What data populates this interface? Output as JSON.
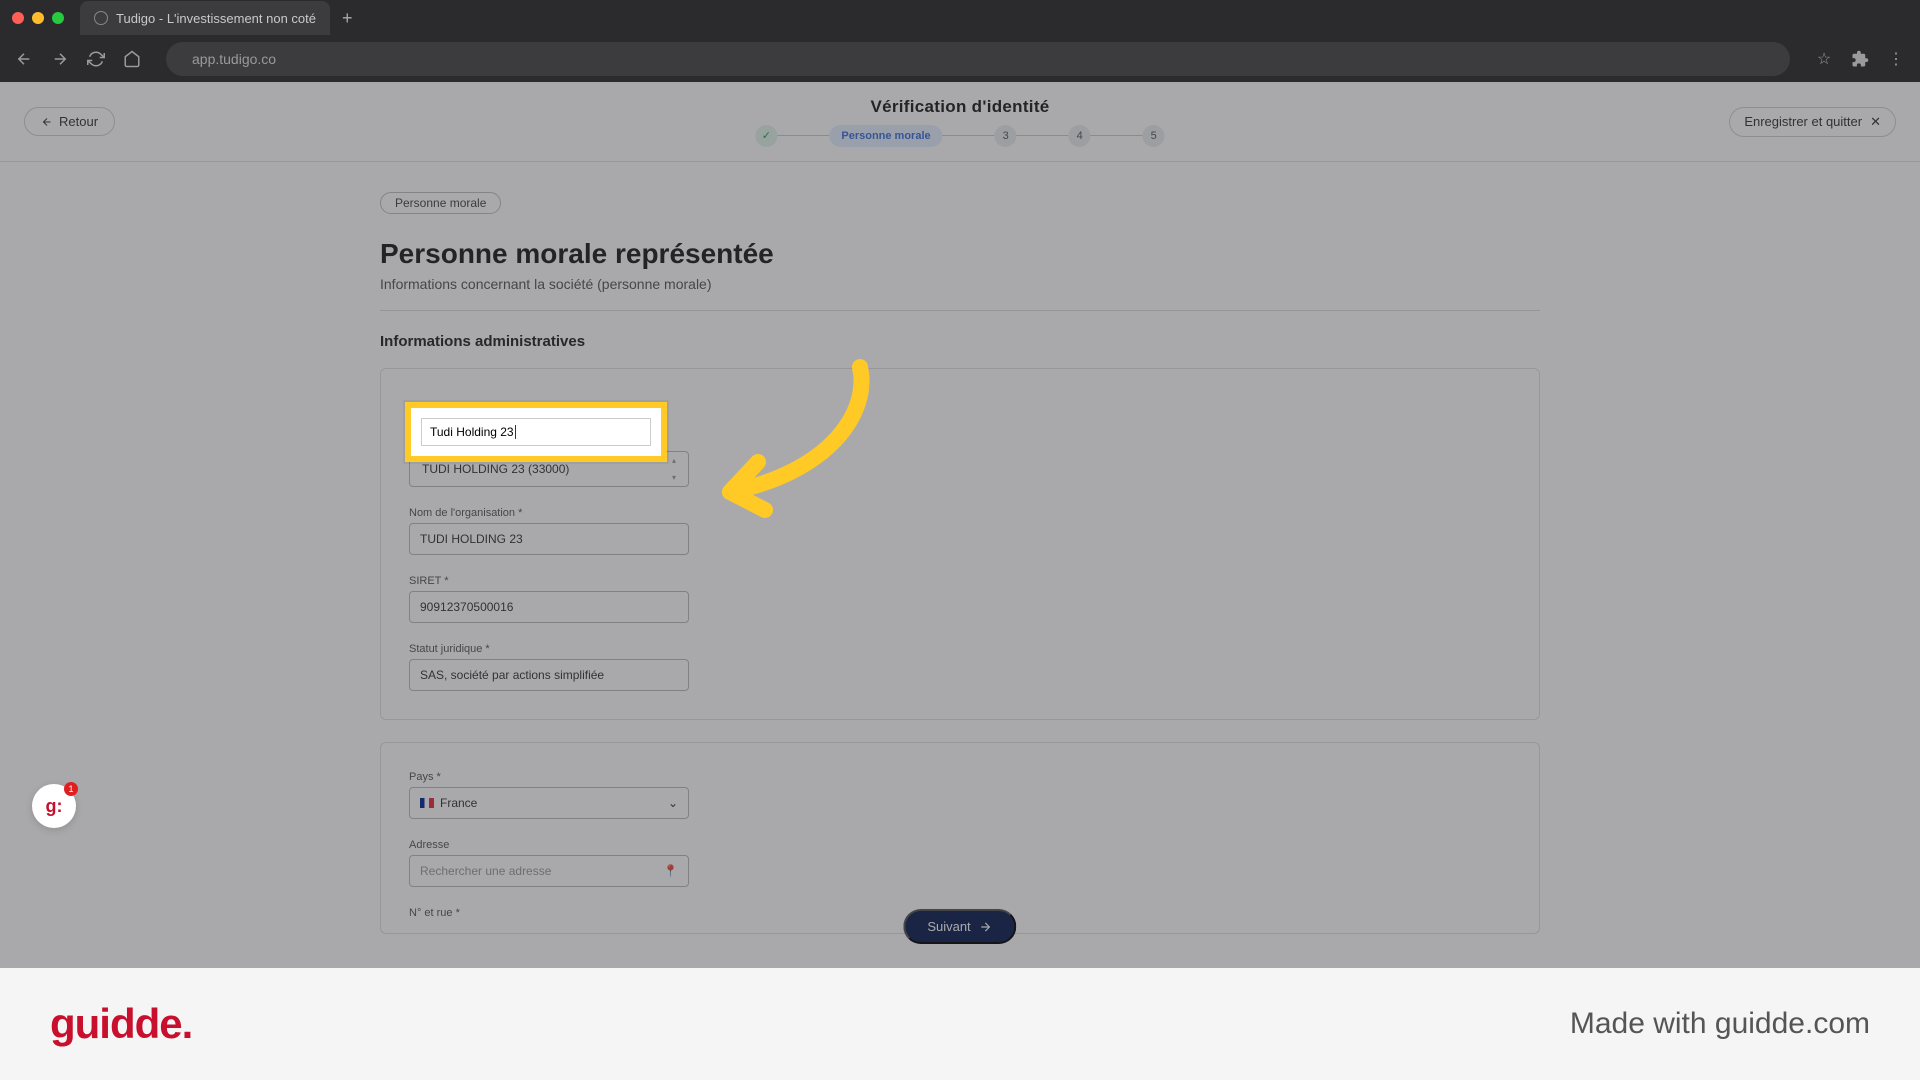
{
  "browser": {
    "tab_title": "Tudigo - L'investissement non coté",
    "url": "app.tudigo.co"
  },
  "header": {
    "back_label": "Retour",
    "title": "Vérification d'identité",
    "save_quit_label": "Enregistrer et quitter",
    "stepper": {
      "step2_label": "Personne morale",
      "step3": "3",
      "step4": "4",
      "step5": "5"
    }
  },
  "content": {
    "badge": "Personne morale",
    "title": "Personne morale représentée",
    "subtitle": "Informations concernant la société (personne morale)",
    "section_heading": "Informations administratives",
    "highlight_input_value": "Tudi Holding 23",
    "suggestion": "TUDI HOLDING 23 (33000)",
    "fields": {
      "org_label": "Nom de l'organisation *",
      "org_value": "TUDI HOLDING 23",
      "siret_label": "SIRET *",
      "siret_value": "90912370500016",
      "statut_label": "Statut juridique *",
      "statut_value": "SAS, société par actions simplifiée",
      "pays_label": "Pays *",
      "pays_value": "France",
      "adresse_label": "Adresse",
      "adresse_placeholder": "Rechercher une adresse",
      "rue_label": "N° et rue *"
    },
    "next_button": "Suivant"
  },
  "widget": {
    "notif_count": "1"
  },
  "footer": {
    "logo": "guidde.",
    "credit": "Made with guidde.com"
  },
  "colors": {
    "highlight": "#ffc926",
    "primary": "#0a1c52",
    "brand_red": "#c8102e"
  }
}
